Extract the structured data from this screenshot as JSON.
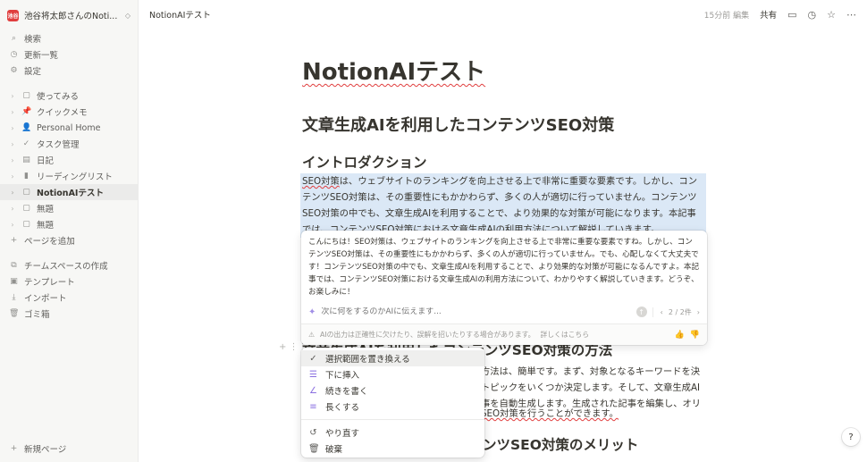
{
  "workspace": {
    "logo": "池谷",
    "name": "池谷将太郎さんのNoti...",
    "toggle": "◇"
  },
  "sidebar": {
    "top": [
      {
        "icon": "⌕",
        "label": "検索"
      },
      {
        "icon": "◷",
        "label": "更新一覧"
      },
      {
        "icon": "⚙",
        "label": "設定"
      }
    ],
    "pages": [
      {
        "icon": "▢",
        "label": "使ってみる"
      },
      {
        "icon": "📌",
        "label": "クイックメモ"
      },
      {
        "icon": "👤",
        "label": "Personal Home"
      },
      {
        "icon": "✓",
        "label": "タスク管理"
      },
      {
        "icon": "▤",
        "label": "日記"
      },
      {
        "icon": "▮",
        "label": "リーディングリスト"
      },
      {
        "icon": "▢",
        "label": "NotionAIテスト"
      },
      {
        "icon": "▢",
        "label": "無題"
      },
      {
        "icon": "▢",
        "label": "無題"
      }
    ],
    "add_page": "ページを追加",
    "tools": [
      {
        "icon": "⧉",
        "label": "チームスペースの作成"
      },
      {
        "icon": "▣",
        "label": "テンプレート"
      },
      {
        "icon": "⤓",
        "label": "インポート"
      },
      {
        "icon": "🗑",
        "label": "ゴミ箱"
      }
    ],
    "new_page": "新規ページ"
  },
  "topbar": {
    "breadcrumb": "NotionAIテスト",
    "edited": "15分前 編集",
    "share": "共有"
  },
  "doc": {
    "title": "NotionAIテスト",
    "h1": "文章生成AIを利用したコンテンツSEO対策",
    "h2": "イントロダクション",
    "para_lead": "SEO対策",
    "para": "は、ウェブサイトのランキングを向上させる上で非常に重要な要素です。しかし、コンテンツSEO対策は、その重要性にもかかわらず、多くの人が適切に行っていません。コンテンツSEO対策の中でも、文章生成AIを利用することで、より効果的な対策が可能になります。本記事では、コンテンツSEO対策における文章生成AIの利用方法について解説していきます。",
    "h2_method": "文章生成AIを利用したコンテンツSEO対策の方法",
    "behind_lines": [
      "方法は、簡単です。まず、対象となるキーワードを決",
      "トピックをいくつか決定します。そして、文章生成AI",
      "事を自動生成します。生成された記事を編集し、オリ"
    ],
    "behind_line4": "SEO対策を行うことができます。",
    "h2_merit": "ンツSEO対策のメリット"
  },
  "ai": {
    "response": "こんにちは！SEO対策は、ウェブサイトのランキングを向上させる上で非常に重要な要素ですね。しかし、コンテンツSEO対策は、その重要性にもかかわらず、多くの人が適切に行っていません。でも、心配しなくて大丈夫です！コンテンツSEO対策の中でも、文章生成AIを利用することで、より効果的な対策が可能になるんですよ。本記事では、コンテンツSEO対策における文章生成AIの利用方法について、わかりやすく解説していきます。どうぞ、お楽しみに！",
    "placeholder": "次に何をするのかAIに伝えます...",
    "pager": "2 / 2件",
    "disclaimer": "AIの出力は正確性に欠けたり、誤解を招いたりする場合があります。",
    "learn_more": "詳しくはこちら"
  },
  "menu": {
    "items": [
      {
        "icon": "✓",
        "label": "選択範囲を置き換える"
      },
      {
        "icon": "☰",
        "label": "下に挿入"
      },
      {
        "icon": "∠",
        "label": "続きを書く"
      },
      {
        "icon": "≡",
        "label": "長くする"
      }
    ],
    "secondary": [
      {
        "icon": "↺",
        "label": "やり直す"
      },
      {
        "icon": "🗑",
        "label": "破棄"
      }
    ]
  },
  "help": "?"
}
